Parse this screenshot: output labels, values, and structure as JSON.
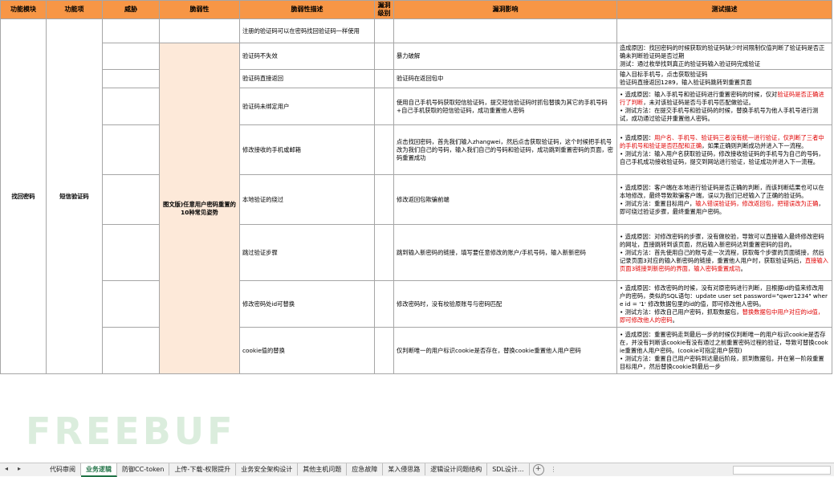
{
  "headers": [
    "功能模块",
    "功能项",
    "威胁",
    "脆弱性",
    "脆弱性描述",
    "漏洞级别",
    "漏洞影响",
    "测试描述"
  ],
  "module": "找回密码",
  "feature": "短信验证码",
  "vulnerability_group": "图文版)任意用户密码重置的10种常见姿势",
  "rows": [
    {
      "desc": "注册的验证码可以在密码找回验证码一样使用",
      "impact": "",
      "test": []
    },
    {
      "desc": "验证码不失效",
      "impact": "暴力破解",
      "test": [
        [
          {
            "t": "造成原因：找回密码的时候获取的验证码缺少时间限制仅值判断了验证码是否正确未判断验证码是否过期"
          }
        ],
        [
          {
            "t": "测试：通过枚举找到真正的验证码输入验证码完成验证"
          }
        ]
      ]
    },
    {
      "desc": "验证码直接返回",
      "impact": "验证码在返回包中",
      "test": [
        [
          {
            "t": "输入目标手机号，点击获取验证码"
          }
        ],
        [
          {
            "t": "验证码直接返回1289，输入验证码跳转到重置页面"
          }
        ]
      ]
    },
    {
      "desc": "验证码未绑定用户",
      "impact": "使用自己手机号码获取短信验证码，提交短信验证码时抓包替换为其它的手机号码+自己手机获取的短信验证码，成功重置他人密码",
      "test": [
        [
          {
            "t": "• 造成原因：输入手机号和验证码进行重置密码的时候，仅对"
          },
          {
            "t": "验证码是否正确进行了判断",
            "r": true
          },
          {
            "t": "，未对该验证码是否与手机号匹配做验证。"
          }
        ],
        [
          {
            "t": "• 测试方法：在提交手机号和验证码的时候，替换手机号为他人手机号进行测试，成功通过验证并重置他人密码。"
          }
        ]
      ]
    },
    {
      "desc": "修改接收的手机或邮箱",
      "impact": "点击找回密码，首先我们输入zhangwei，然后点击获取验证码，这个时候把手机号改为我们自己的号码，输入我们自己的号码和验证码，成功跳到重置密码的页面，密码重置成功",
      "test": [
        [
          {
            "t": "• 造成原因："
          },
          {
            "t": "用户名、手机号、验证码三者没有统一进行验证，仅判断了三者中的手机号和验证是否匹配和正确",
            "r": true
          },
          {
            "t": "，如果正确则判断成功并进入下一流程。"
          }
        ],
        [
          {
            "t": "• 测试方法：输入用户名获取验证码，修改接收验证码的手机号为自己的号码，自己手机成功接收验证码，提交到网站进行验证，验证成功并进入下一流程。"
          }
        ]
      ]
    },
    {
      "desc": "本地验证的绕过",
      "impact": "修改返回包欺骗前端",
      "test": [
        [
          {
            "t": "• 造成原因：客户端在本地进行验证码是否正确的判断，而该判断结果也可以在本地修改，最终导致欺骗客户端，误以为我们已经输入了正确的验证码。"
          }
        ],
        [
          {
            "t": "• 测试方法：重置目标用户，"
          },
          {
            "t": "输入错误验证码，修改返回包，把错误改为正确",
            "r": true
          },
          {
            "t": "，即可绕过验证步骤，最终重置用户密码。"
          }
        ]
      ]
    },
    {
      "desc": "跳过验证步骤",
      "impact": "跳到输入新密码的链接，填写要任意修改的账户/手机号码，输入新新密码",
      "test": [
        [
          {
            "t": "• 造成原因：对修改密码的步骤，没有做校验，导致可以直接输入最终修改密码的网址，直接跳转到该页面，然后输入新密码达到重置密码的目的。"
          }
        ],
        [
          {
            "t": "• 测试方法：首先使用自己的账号走一次流程，获取每个步骤的页面链接，然后记录页面3对应的输入新密码的链接，重置他人用户时，获取验证码后，"
          },
          {
            "t": "直接输入页面3链接到新密码的界面，输入密码重置成功",
            "r": true
          },
          {
            "t": "。"
          }
        ]
      ]
    },
    {
      "desc": "修改密码处id可替换",
      "impact": "修改密码时，没有校验原账号与密码匹配",
      "test": [
        [
          {
            "t": "• 造成原因：修改密码的时候，没有对原密码进行判断，且根据id的值来修改用户的密码，类似的SQL语句：update user set password=\"qwer1234\" where id = '1' 修改数据包里的id的值，即可修改他人密码。"
          }
        ],
        [
          {
            "t": "• 测试方法：修改自己用户密码，抓取数据包，"
          },
          {
            "t": "替换数据包中用户对应的id值，即可修改他人的密码",
            "r": true
          },
          {
            "t": "。"
          }
        ]
      ]
    },
    {
      "desc": "cookie值的替换",
      "impact": "仅判断唯一的用户标识cookie是否存在，替换cookie重置他人用户密码",
      "test": [
        [
          {
            "t": "• 造成原因：重置密码走到最后一步的时候仅判断唯一的用户标识cookie是否存在，并没有判断该cookie有没有通过之前重置密码过程的验证，导致可替换cookie重置他人用户密码。(cookie可指定用户获取)"
          }
        ],
        [
          {
            "t": "• 测试方法：重置自己用户密码到达最后阶段，抓到数据包，并在第一阶段重置目标用户，然后替换cookie到最后一步"
          }
        ]
      ]
    }
  ],
  "watermark": "FREEBUF",
  "sheet_tabs": [
    "代码审阅",
    "业务逻辑",
    "防御CC-token",
    "上传-下载-权限提升",
    "业务安全架构设计",
    "其他主机问题",
    "应急故障",
    "某入侵思路",
    "逻辑设计问题结构",
    "SDL设计..."
  ],
  "active_tab_index": 1,
  "colors": {
    "header": "#f79646",
    "vulnerability_cell": "#fde9d9",
    "highlight_text": "#e00000",
    "active_tab": "#217346"
  }
}
